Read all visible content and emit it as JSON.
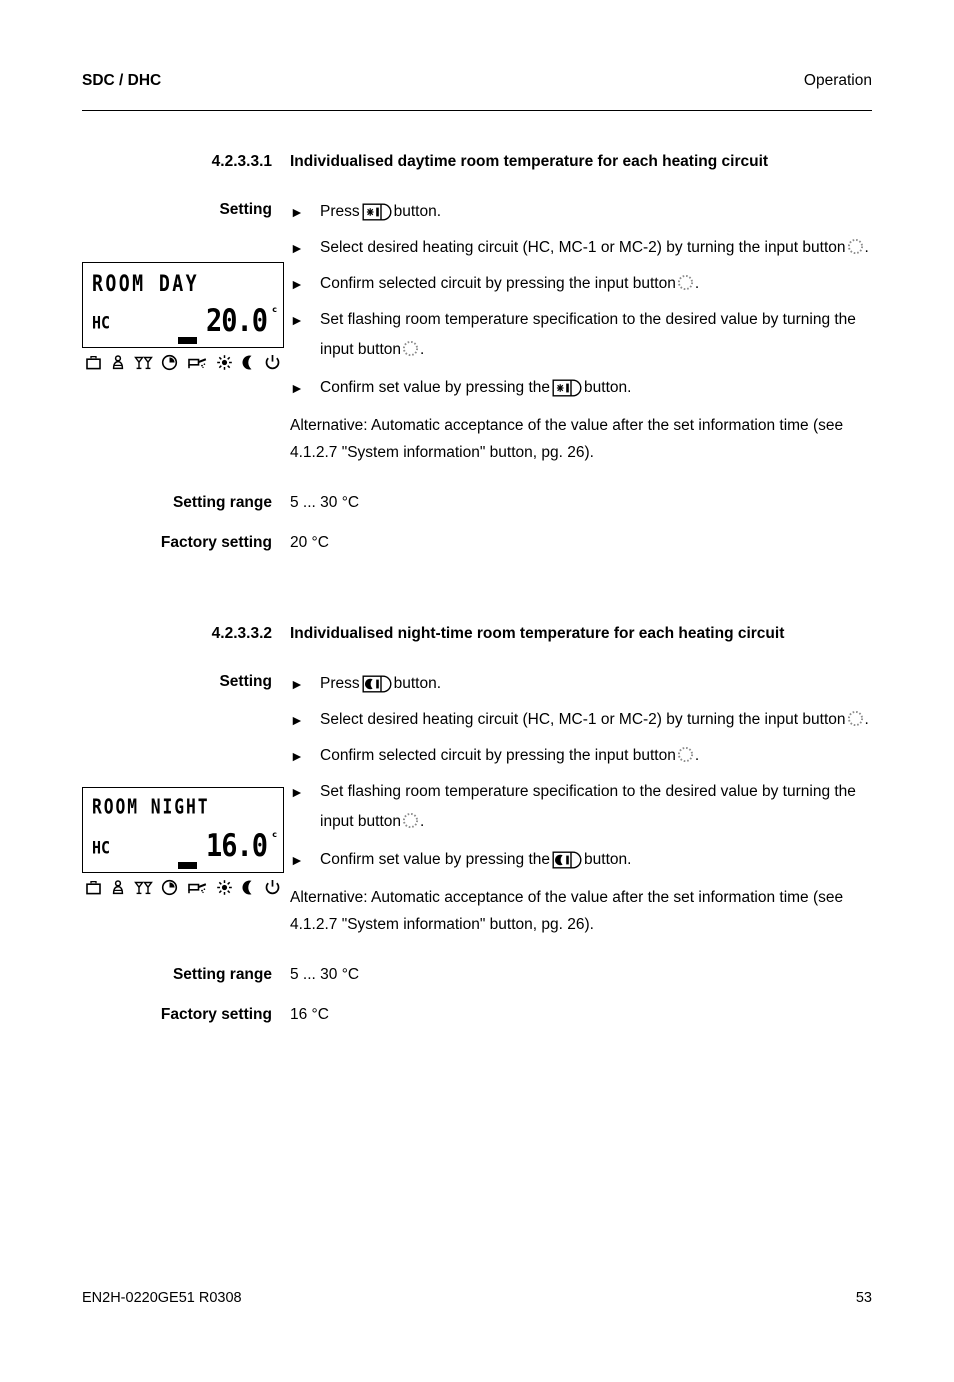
{
  "header": {
    "left": "SDC / DHC",
    "right": "Operation"
  },
  "footer": {
    "doc_code": "EN2H-0220GE51 R0308",
    "page_number": "53"
  },
  "sections": [
    {
      "number": "4.2.3.3.1",
      "title": "Individualised daytime room temperature for each heating circuit",
      "setting_label": "Setting",
      "lcd": {
        "line1": "ROOM DAY",
        "circuit": "HC",
        "value": "20.0",
        "unit": "c",
        "icons": [
          "briefcase-icon",
          "person-seated-icon",
          "cocktail-glasses-icon",
          "clock-icon",
          "hand-tap-icon",
          "sun-icon",
          "moon-icon",
          "standby-power-icon"
        ]
      },
      "steps": [
        {
          "marker": "►",
          "pre": "Press",
          "icon": "sun-button-icon",
          "post": "button."
        },
        {
          "marker": "►",
          "pre": "Select desired heating circuit (HC, MC-1 or MC-2) by turning the input button",
          "icon": "input-knob-icon",
          "post": "."
        },
        {
          "marker": "►",
          "pre": "Confirm selected circuit by pressing the input button",
          "icon": "input-knob-icon",
          "post": "."
        },
        {
          "marker": "►",
          "pre": "Set flashing room temperature specification to the desired value by turning the input button",
          "icon": "input-knob-icon",
          "post": "."
        },
        {
          "marker": "►",
          "pre": "Confirm set value by pressing the",
          "icon": "sun-button-icon",
          "post": "button."
        }
      ],
      "note": "Alternative: Automatic acceptance of the value after the set information time (see 4.1.2.7 \"System information\" button, pg. 26).",
      "setting_range_label": "Setting range",
      "setting_range_value": "5 ... 30 °C",
      "factory_setting_label": "Factory setting",
      "factory_setting_value": "20 °C"
    },
    {
      "number": "4.2.3.3.2",
      "title": "Individualised night-time room temperature for each heating circuit",
      "setting_label": "Setting",
      "lcd": {
        "line1": "ROOM NIGHT",
        "circuit": "HC",
        "value": "16.0",
        "unit": "c",
        "icons": [
          "briefcase-icon",
          "person-seated-icon",
          "cocktail-glasses-icon",
          "clock-icon",
          "hand-tap-icon",
          "sun-icon",
          "moon-icon",
          "standby-power-icon"
        ]
      },
      "steps": [
        {
          "marker": "►",
          "pre": "Press",
          "icon": "moon-button-icon",
          "post": "button."
        },
        {
          "marker": "►",
          "pre": "Select desired heating circuit (HC, MC-1 or MC-2) by turning the input button",
          "icon": "input-knob-icon",
          "post": "."
        },
        {
          "marker": "►",
          "pre": "Confirm selected circuit by pressing the input button",
          "icon": "input-knob-icon",
          "post": "."
        },
        {
          "marker": "►",
          "pre": "Set flashing room temperature specification to the desired value by turning the input button",
          "icon": "input-knob-icon",
          "post": "."
        },
        {
          "marker": "►",
          "pre": "Confirm set value by pressing the",
          "icon": "moon-button-icon",
          "post": "button."
        }
      ],
      "note": "Alternative: Automatic acceptance of the value after the set information time (see 4.1.2.7 \"System information\" button, pg. 26).",
      "setting_range_label": "Setting range",
      "setting_range_value": "5 ... 30 °C",
      "factory_setting_label": "Factory setting",
      "factory_setting_value": "16 °C"
    }
  ]
}
